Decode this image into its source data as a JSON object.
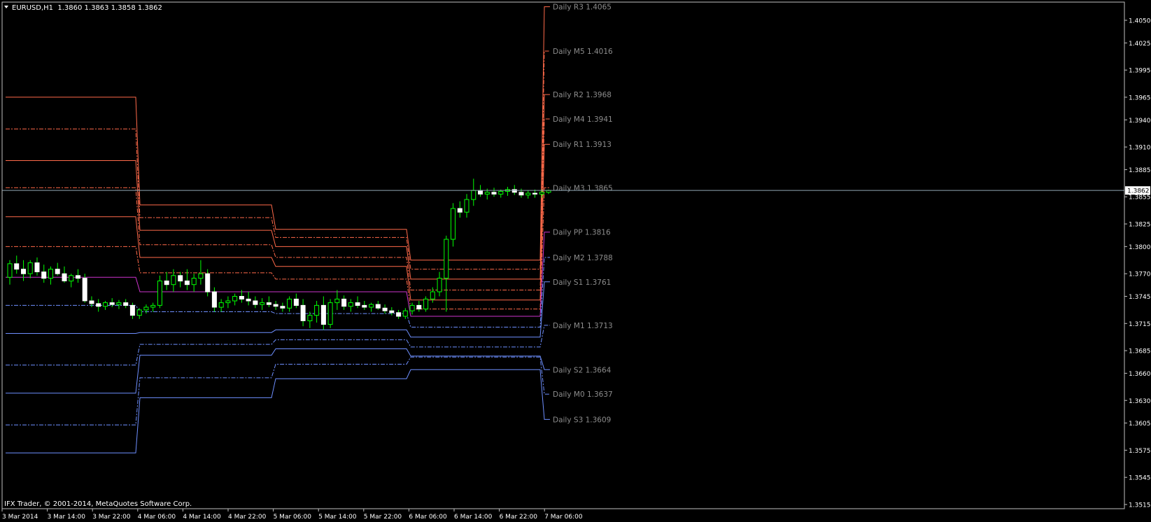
{
  "window": {
    "symbol_line": "EURUSD,H1  1.3860 1.3863 1.3858 1.3862",
    "copyright": "IFX Trader, © 2001-2014, MetaQuotes Software Corp.",
    "current_price_label": "1.3862"
  },
  "chart_data": {
    "type": "candlestick",
    "symbol": "EURUSD",
    "timeframe": "H1",
    "last_bar": {
      "open": 1.386,
      "high": 1.3863,
      "low": 1.3858,
      "close": 1.3862
    },
    "current_price": 1.3862,
    "ylim": [
      1.3505,
      1.4075
    ],
    "y_ticks": [
      "1.4050",
      "1.4025",
      "1.3995",
      "1.3965",
      "1.3940",
      "1.3910",
      "1.3885",
      "1.3855",
      "1.3825",
      "1.3800",
      "1.3770",
      "1.3745",
      "1.3715",
      "1.3685",
      "1.3660",
      "1.3630",
      "1.3605",
      "1.3575",
      "1.3545",
      "1.3515"
    ],
    "x_ticks": [
      "3 Mar 2014",
      "3 Mar 14:00",
      "3 Mar 22:00",
      "4 Mar 06:00",
      "4 Mar 14:00",
      "4 Mar 22:00",
      "5 Mar 06:00",
      "5 Mar 14:00",
      "5 Mar 22:00",
      "6 Mar 06:00",
      "6 Mar 14:00",
      "6 Mar 22:00",
      "7 Mar 06:00"
    ],
    "levels": [
      {
        "name": "R3",
        "label": "Daily R3 1.4065",
        "value": 1.4065,
        "color": "#ff6a4a",
        "style": "solid",
        "history": [
          1.3965,
          1.3846,
          1.3819,
          1.3785
        ]
      },
      {
        "name": "M5",
        "label": "Daily M5 1.4016",
        "value": 1.4016,
        "color": "#ff6a4a",
        "style": "dashdot",
        "history": [
          1.393,
          1.3832,
          1.381,
          1.3775
        ]
      },
      {
        "name": "R2",
        "label": "Daily R2 1.3968",
        "value": 1.3968,
        "color": "#ff6a4a",
        "style": "solid",
        "history": [
          1.3895,
          1.3818,
          1.38,
          1.3764
        ]
      },
      {
        "name": "M4",
        "label": "Daily M4 1.3941",
        "value": 1.3941,
        "color": "#ff6a4a",
        "style": "dashdot",
        "history": [
          1.3865,
          1.3802,
          1.3788,
          1.3752
        ]
      },
      {
        "name": "R1",
        "label": "Daily R1 1.3913",
        "value": 1.3913,
        "color": "#ff6a4a",
        "style": "solid",
        "history": [
          1.3833,
          1.3788,
          1.3778,
          1.3741
        ]
      },
      {
        "name": "M3",
        "label": "Daily M3 1.3865",
        "value": 1.3865,
        "color": "#ff6a4a",
        "style": "dashdot",
        "history": [
          1.38,
          1.3771,
          1.3764,
          1.3731
        ]
      },
      {
        "name": "PP",
        "label": "Daily PP 1.3816",
        "value": 1.3816,
        "color": "#cc33cc",
        "style": "solid",
        "history": [
          1.3766,
          1.375,
          1.375,
          1.3723
        ]
      },
      {
        "name": "M2",
        "label": "Daily M2 1.3788",
        "value": 1.3788,
        "color": "#6e8fff",
        "style": "dashdot",
        "history": [
          1.3735,
          1.3728,
          1.3726,
          1.3711
        ]
      },
      {
        "name": "S1",
        "label": "Daily S1 1.3761",
        "value": 1.3761,
        "color": "#6e8fff",
        "style": "solid",
        "history": [
          1.3704,
          1.3705,
          1.3708,
          1.37
        ]
      },
      {
        "name": "M1",
        "label": "Daily M1 1.3713",
        "value": 1.3713,
        "color": "#6e8fff",
        "style": "dashdot",
        "history": [
          1.3669,
          1.3692,
          1.3697,
          1.3689
        ]
      },
      {
        "name": "S2",
        "label": "Daily S2 1.3664",
        "value": 1.3664,
        "color": "#6e8fff",
        "style": "solid",
        "history": [
          1.3638,
          1.368,
          1.3687,
          1.3679
        ]
      },
      {
        "name": "M0",
        "label": "Daily M0 1.3637",
        "value": 1.3637,
        "color": "#6e8fff",
        "style": "dashdot",
        "history": [
          1.3603,
          1.3655,
          1.367,
          1.3678
        ]
      },
      {
        "name": "S3",
        "label": "Daily S3 1.3609",
        "value": 1.3609,
        "color": "#6e8fff",
        "style": "solid",
        "history": [
          1.3572,
          1.3633,
          1.3654,
          1.3664
        ]
      }
    ],
    "candles": [
      [
        1.3766,
        1.3785,
        1.3758,
        1.3781
      ],
      [
        1.3781,
        1.379,
        1.377,
        1.3775
      ],
      [
        1.3775,
        1.3785,
        1.3762,
        1.377
      ],
      [
        1.377,
        1.3785,
        1.3765,
        1.3782
      ],
      [
        1.3782,
        1.3788,
        1.3768,
        1.3772
      ],
      [
        1.3772,
        1.378,
        1.376,
        1.3765
      ],
      [
        1.3765,
        1.3778,
        1.3758,
        1.3775
      ],
      [
        1.3775,
        1.3782,
        1.3768,
        1.377
      ],
      [
        1.377,
        1.3778,
        1.376,
        1.3762
      ],
      [
        1.3762,
        1.377,
        1.3755,
        1.3768
      ],
      [
        1.3768,
        1.3775,
        1.376,
        1.3765
      ],
      [
        1.3765,
        1.377,
        1.3738,
        1.374
      ],
      [
        1.374,
        1.3745,
        1.3733,
        1.3737
      ],
      [
        1.3737,
        1.3742,
        1.3728,
        1.3734
      ],
      [
        1.3734,
        1.374,
        1.373,
        1.3738
      ],
      [
        1.3738,
        1.3743,
        1.3733,
        1.3736
      ],
      [
        1.3736,
        1.3741,
        1.3731,
        1.3738
      ],
      [
        1.3738,
        1.3742,
        1.3732,
        1.3735
      ],
      [
        1.3735,
        1.3738,
        1.372,
        1.3724
      ],
      [
        1.3724,
        1.3732,
        1.372,
        1.373
      ],
      [
        1.373,
        1.3736,
        1.3726,
        1.3733
      ],
      [
        1.3733,
        1.3738,
        1.3728,
        1.3735
      ],
      [
        1.3735,
        1.3768,
        1.3732,
        1.3762
      ],
      [
        1.3762,
        1.3772,
        1.3752,
        1.3758
      ],
      [
        1.3758,
        1.3775,
        1.375,
        1.3768
      ],
      [
        1.3768,
        1.3772,
        1.3755,
        1.3762
      ],
      [
        1.3762,
        1.3775,
        1.3752,
        1.3758
      ],
      [
        1.3758,
        1.377,
        1.375,
        1.3765
      ],
      [
        1.3765,
        1.3785,
        1.3758,
        1.377
      ],
      [
        1.377,
        1.3775,
        1.3745,
        1.375
      ],
      [
        1.375,
        1.3755,
        1.3728,
        1.3733
      ],
      [
        1.3733,
        1.3742,
        1.3728,
        1.3738
      ],
      [
        1.3738,
        1.3745,
        1.3732,
        1.374
      ],
      [
        1.374,
        1.3748,
        1.3735,
        1.3745
      ],
      [
        1.3745,
        1.3752,
        1.3738,
        1.3742
      ],
      [
        1.3742,
        1.375,
        1.3735,
        1.374
      ],
      [
        1.374,
        1.3745,
        1.3732,
        1.3736
      ],
      [
        1.3736,
        1.3743,
        1.373,
        1.3738
      ],
      [
        1.3738,
        1.3745,
        1.3733,
        1.3736
      ],
      [
        1.3736,
        1.374,
        1.373,
        1.3734
      ],
      [
        1.3734,
        1.3738,
        1.3728,
        1.3732
      ],
      [
        1.3732,
        1.3745,
        1.3728,
        1.3742
      ],
      [
        1.3742,
        1.3748,
        1.3732,
        1.3735
      ],
      [
        1.3735,
        1.3742,
        1.3712,
        1.3718
      ],
      [
        1.3718,
        1.3728,
        1.371,
        1.3724
      ],
      [
        1.3724,
        1.374,
        1.3716,
        1.3735
      ],
      [
        1.3735,
        1.3745,
        1.3708,
        1.3714
      ],
      [
        1.3714,
        1.3742,
        1.371,
        1.3738
      ],
      [
        1.3738,
        1.3752,
        1.373,
        1.3742
      ],
      [
        1.3742,
        1.3746,
        1.373,
        1.3734
      ],
      [
        1.3734,
        1.3742,
        1.3728,
        1.3738
      ],
      [
        1.3738,
        1.3745,
        1.3732,
        1.3735
      ],
      [
        1.3735,
        1.374,
        1.373,
        1.3733
      ],
      [
        1.3733,
        1.3738,
        1.3728,
        1.3736
      ],
      [
        1.3736,
        1.374,
        1.373,
        1.3732
      ],
      [
        1.3732,
        1.3736,
        1.3726,
        1.3729
      ],
      [
        1.3729,
        1.3733,
        1.3724,
        1.3727
      ],
      [
        1.3727,
        1.373,
        1.372,
        1.3723
      ],
      [
        1.3723,
        1.3732,
        1.372,
        1.3729
      ],
      [
        1.3729,
        1.3738,
        1.3725,
        1.3735
      ],
      [
        1.3735,
        1.374,
        1.3728,
        1.3731
      ],
      [
        1.3731,
        1.3745,
        1.3728,
        1.3742
      ],
      [
        1.3742,
        1.3755,
        1.3738,
        1.375
      ],
      [
        1.375,
        1.3772,
        1.3745,
        1.3765
      ],
      [
        1.3765,
        1.3812,
        1.3728,
        1.3808
      ],
      [
        1.3808,
        1.3848,
        1.38,
        1.3842
      ],
      [
        1.3842,
        1.385,
        1.3832,
        1.3838
      ],
      [
        1.3838,
        1.3858,
        1.3832,
        1.3852
      ],
      [
        1.3852,
        1.3875,
        1.3845,
        1.3862
      ],
      [
        1.3862,
        1.3868,
        1.3855,
        1.3858
      ],
      [
        1.3858,
        1.3864,
        1.3852,
        1.386
      ],
      [
        1.386,
        1.3865,
        1.3855,
        1.3858
      ],
      [
        1.3858,
        1.3863,
        1.3854,
        1.3861
      ],
      [
        1.3861,
        1.3866,
        1.3856,
        1.3863
      ],
      [
        1.3863,
        1.3868,
        1.3857,
        1.386
      ],
      [
        1.386,
        1.3864,
        1.3854,
        1.3857
      ],
      [
        1.3857,
        1.3862,
        1.3853,
        1.3859
      ],
      [
        1.3859,
        1.3863,
        1.3854,
        1.3858
      ],
      [
        1.3858,
        1.3863,
        1.3854,
        1.386
      ],
      [
        1.386,
        1.3863,
        1.3858,
        1.3862
      ]
    ]
  }
}
